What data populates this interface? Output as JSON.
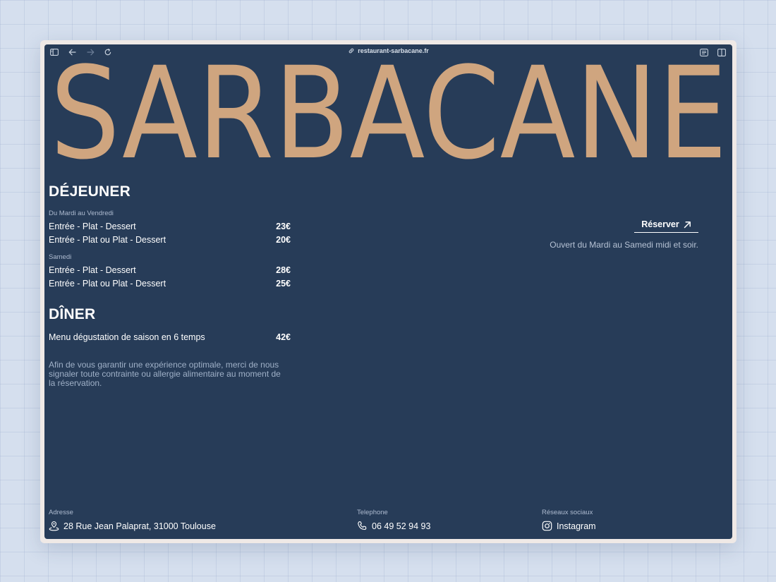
{
  "browser": {
    "url": "restaurant-sarbacane.fr"
  },
  "brand": {
    "name": "SARBACANE",
    "color": "#cfa57f"
  },
  "lunch": {
    "title": "DÉJEUNER",
    "groups": [
      {
        "label": "Du Mardi au Vendredi",
        "items": [
          {
            "name": "Entrée - Plat - Dessert",
            "price": "23€"
          },
          {
            "name": "Entrée - Plat ou Plat - Dessert",
            "price": "20€"
          }
        ]
      },
      {
        "label": "Samedi",
        "items": [
          {
            "name": "Entrée - Plat - Dessert",
            "price": "28€"
          },
          {
            "name": "Entrée - Plat ou Plat - Dessert",
            "price": "25€"
          }
        ]
      }
    ]
  },
  "dinner": {
    "title": "DÎNER",
    "items": [
      {
        "name": "Menu dégustation de saison en 6 temps",
        "price": "42€"
      }
    ]
  },
  "note": "Afin de vous garantir une expérience optimale, merci de nous signaler toute contrainte ou allergie alimentaire au moment de la réservation.",
  "reservation": {
    "label": "Réserver",
    "hours": "Ouvert du Mardi au Samedi midi et soir."
  },
  "footer": {
    "address": {
      "label": "Adresse",
      "value": "28 Rue Jean Palaprat, 31000 Toulouse"
    },
    "phone": {
      "label": "Telephone",
      "value": "06 49 52 94 93"
    },
    "social": {
      "label": "Réseaux sociaux",
      "value": "Instagram"
    }
  },
  "icons": {
    "sidebar": "sidebar-icon",
    "back": "arrow-left-icon",
    "forward": "arrow-right-icon",
    "reload": "reload-icon",
    "link": "link-icon",
    "reader": "reader-icon",
    "split": "split-view-icon",
    "arrow": "arrow-up-right-icon",
    "pin": "map-pin-icon",
    "phone": "phone-icon",
    "instagram": "instagram-icon"
  }
}
